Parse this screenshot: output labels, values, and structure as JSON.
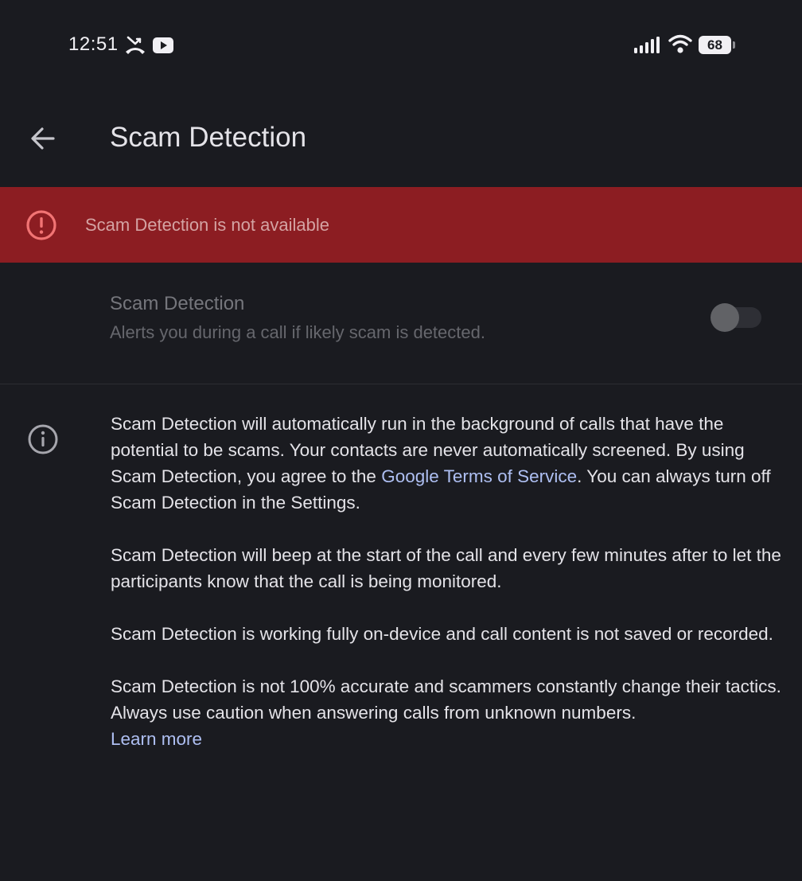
{
  "status_bar": {
    "time": "12:51",
    "icons": [
      "missed-call-icon",
      "youtube-icon",
      "signal-icon",
      "wifi-icon",
      "battery-icon"
    ],
    "battery_level": "68"
  },
  "app_bar": {
    "back_icon": "arrow-back-icon",
    "title": "Scam Detection"
  },
  "banner": {
    "icon": "error-icon",
    "text": "Scam Detection is not available",
    "color": "#8c1d22"
  },
  "setting": {
    "title": "Scam Detection",
    "summary": "Alerts you during a call if likely scam is detected.",
    "enabled": false
  },
  "info": {
    "icon": "info-icon",
    "paragraph1_before_link": "Scam Detection will automatically run in the background of calls that have the potential to be scams. Your contacts are never automatically screened. By using Scam Detection, you agree to the ",
    "paragraph1_link": "Google Terms of Service",
    "paragraph1_after_link": ". You can always turn off Scam Detection in the Settings.",
    "paragraph2": "Scam Detection will beep at the start of the call and every few minutes after to let the participants know that the call is being monitored.",
    "paragraph3": "Scam Detection is working fully on-device and call content is not saved or recorded.",
    "paragraph4": "Scam Detection is not 100% accurate and scammers constantly change their tactics. Always use caution when answering calls from unknown numbers.",
    "learn_more": "Learn more"
  },
  "colors": {
    "background": "#1a1b20",
    "link": "#aebff2",
    "error_icon": "#f27474"
  }
}
